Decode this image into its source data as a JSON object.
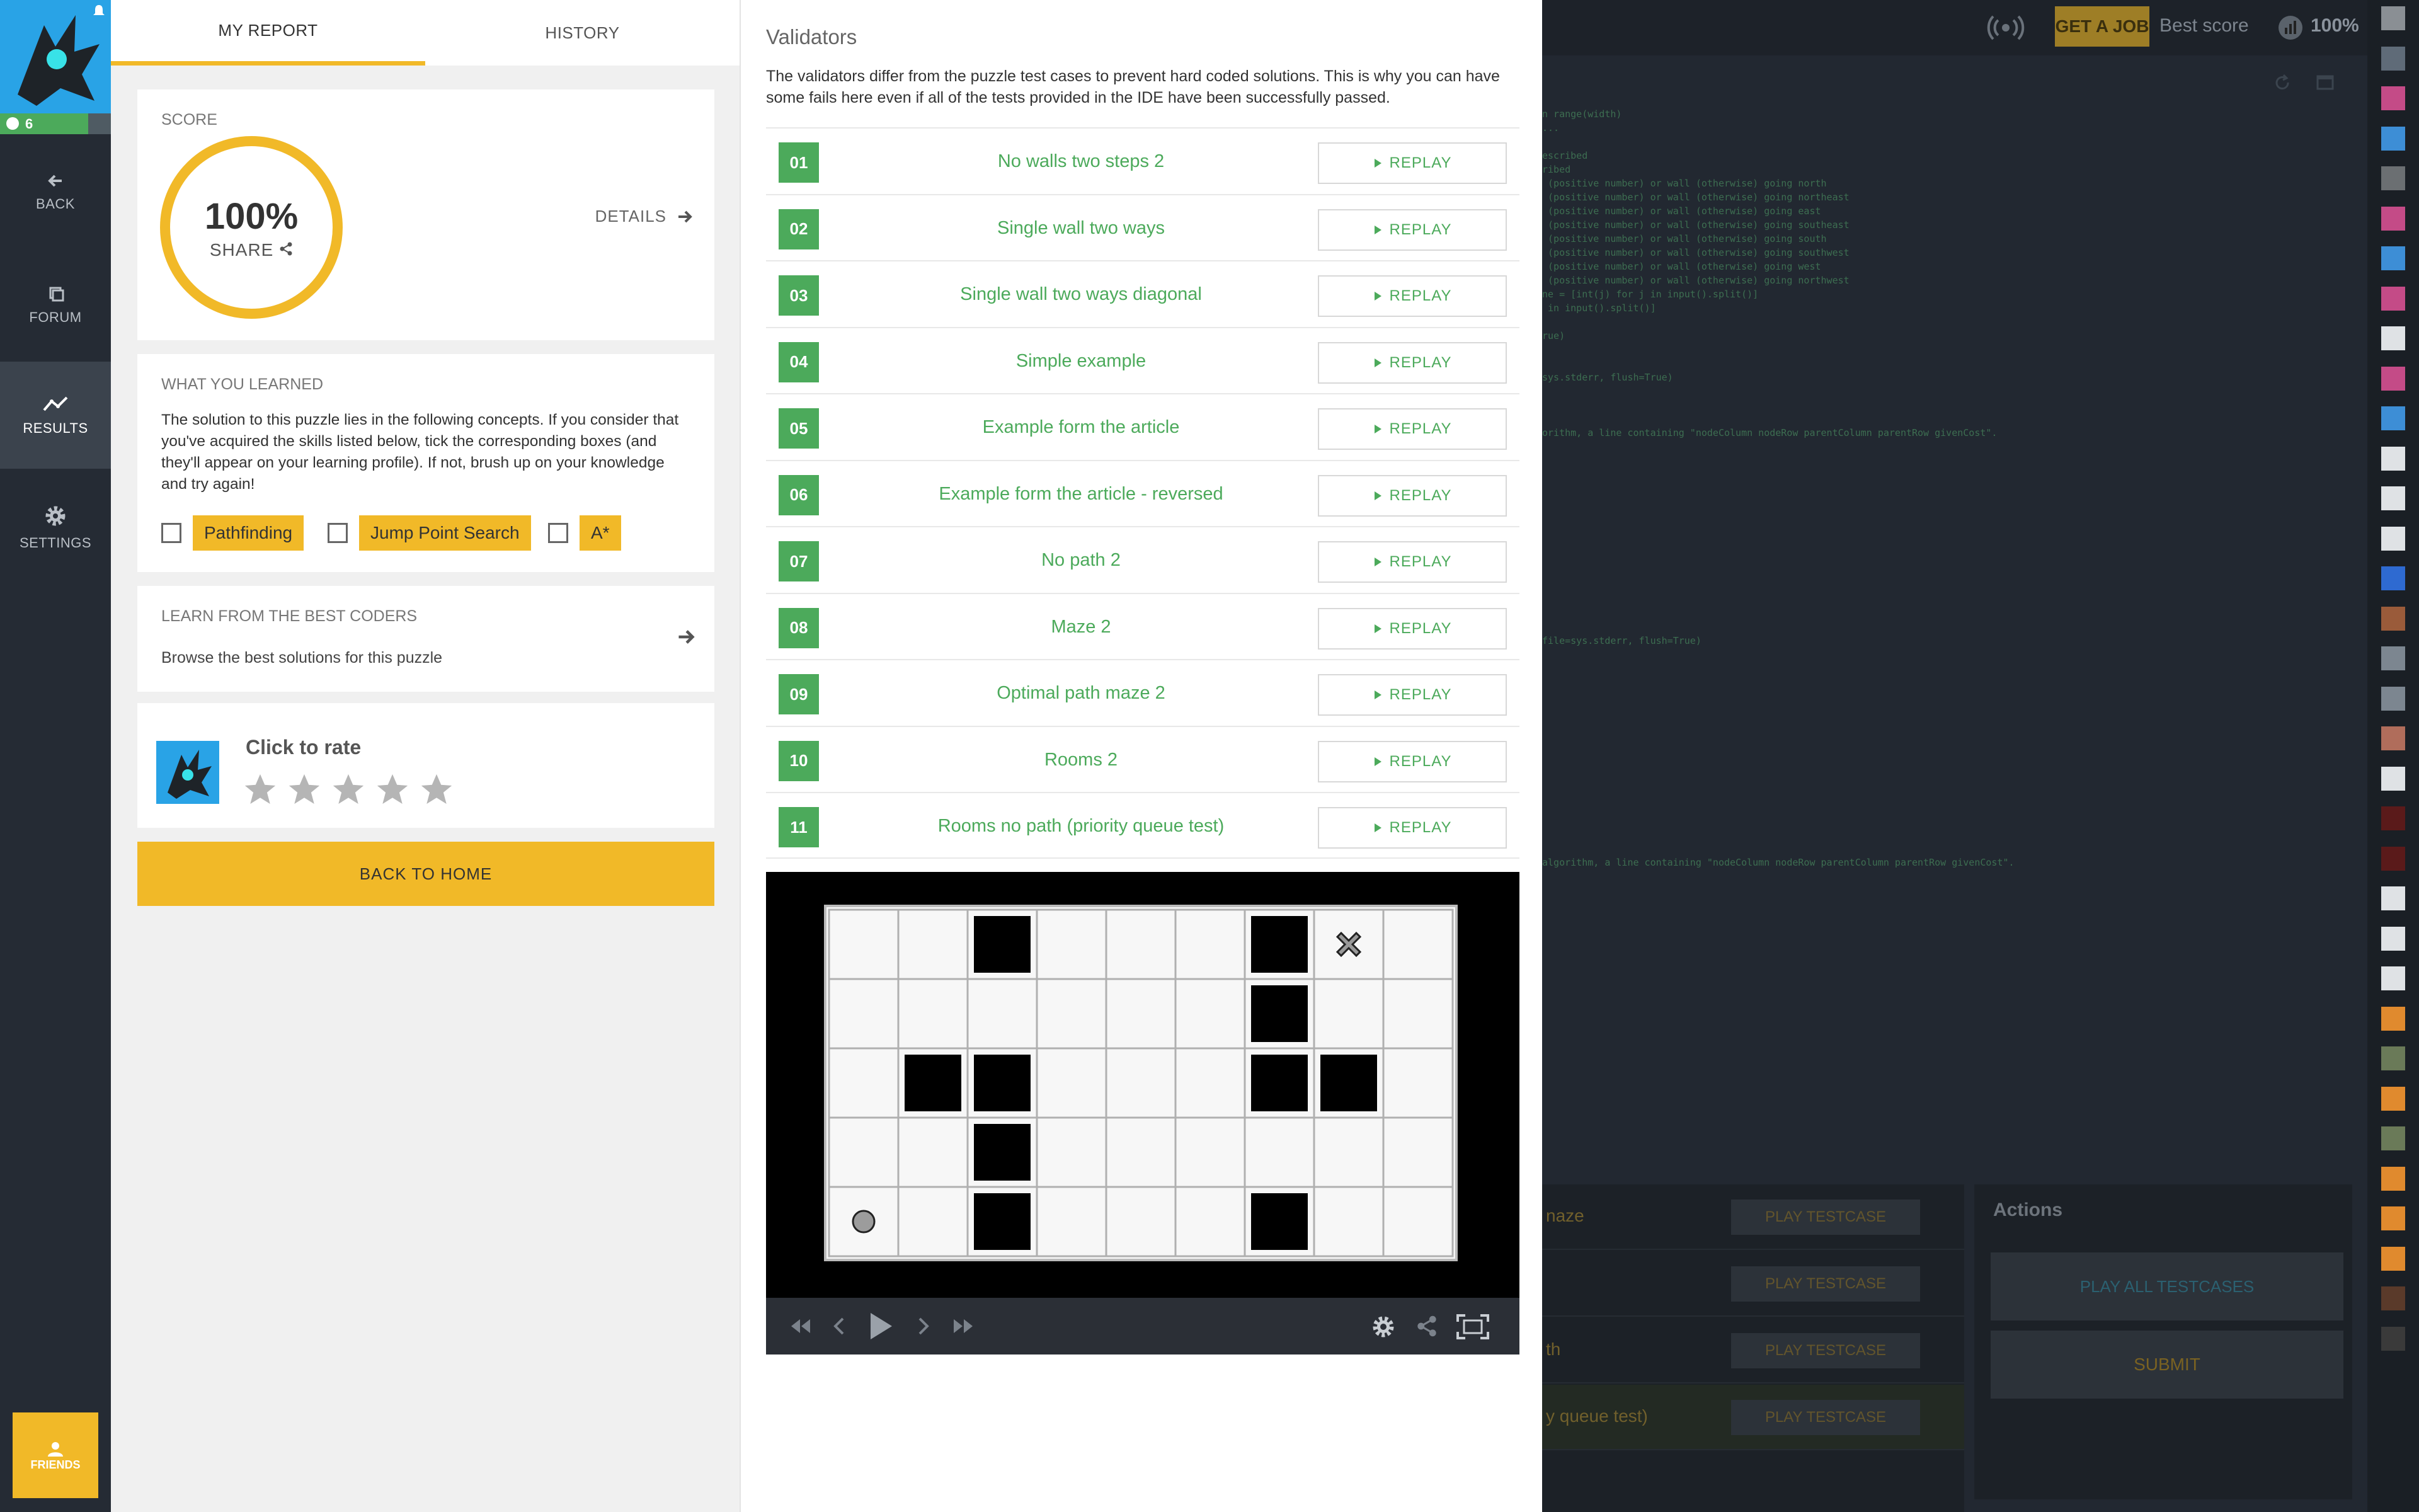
{
  "nav": {
    "level": "6",
    "back": "BACK",
    "forum": "FORUM",
    "results": "RESULTS",
    "settings": "SETTINGS",
    "friends": "FRIENDS"
  },
  "report": {
    "tab_report": "MY REPORT",
    "tab_history": "HISTORY",
    "score_title": "SCORE",
    "score_value": "100%",
    "score_fraction": 1.0,
    "share": "SHARE",
    "details": "DETAILS",
    "learned_title": "WHAT YOU LEARNED",
    "learned_desc": "The solution to this puzzle lies in the following concepts. If you consider that you've acquired the skills listed below, tick the corresponding boxes (and they'll appear on your learning profile). If not, brush up on your knowledge and try again!",
    "skills": [
      "Pathfinding",
      "Jump Point Search",
      "A*"
    ],
    "best_title": "LEARN FROM THE BEST CODERS",
    "best_sub": "Browse the best solutions for this puzzle",
    "rate_title": "Click to rate",
    "rating": 0,
    "home_button": "BACK TO HOME"
  },
  "validators": {
    "title": "Validators",
    "intro": "The validators differ from the puzzle test cases to prevent hard coded solutions. This is why you can have some fails here even if all of the tests provided in the IDE have been successfully passed.",
    "replay": "REPLAY",
    "items": [
      {
        "num": "01",
        "name": "No walls two steps 2"
      },
      {
        "num": "02",
        "name": "Single wall two ways"
      },
      {
        "num": "03",
        "name": "Single wall two ways diagonal"
      },
      {
        "num": "04",
        "name": "Simple example"
      },
      {
        "num": "05",
        "name": "Example form the article"
      },
      {
        "num": "06",
        "name": "Example form the article - reversed"
      },
      {
        "num": "07",
        "name": "No path 2"
      },
      {
        "num": "08",
        "name": "Maze 2"
      },
      {
        "num": "09",
        "name": "Optimal path maze 2"
      },
      {
        "num": "10",
        "name": "Rooms 2"
      },
      {
        "num": "11",
        "name": "Rooms no path (priority queue test)"
      }
    ],
    "grid": {
      "cols": 9,
      "rows": 5,
      "walls": [
        [
          2,
          0
        ],
        [
          6,
          0
        ],
        [
          6,
          1
        ],
        [
          1,
          2
        ],
        [
          2,
          2
        ],
        [
          6,
          2
        ],
        [
          7,
          2
        ],
        [
          2,
          3
        ],
        [
          2,
          4
        ],
        [
          6,
          4
        ]
      ],
      "goal": [
        7,
        0
      ],
      "start": [
        0,
        4
      ]
    }
  },
  "ide": {
    "get_job": "GET A JOB",
    "best_score_label": "Best score",
    "best_score_value": "100%",
    "actions_title": "Actions",
    "play_all": "PLAY ALL TESTCASES",
    "submit": "SUBMIT",
    "play_testcase": "PLAY TESTCASE",
    "tests": [
      "naze",
      "",
      "th",
      "y queue test)"
    ]
  },
  "colors": {
    "accent": "#f1b928",
    "success": "#4caa5b",
    "brand_blue": "#29a3e6"
  }
}
